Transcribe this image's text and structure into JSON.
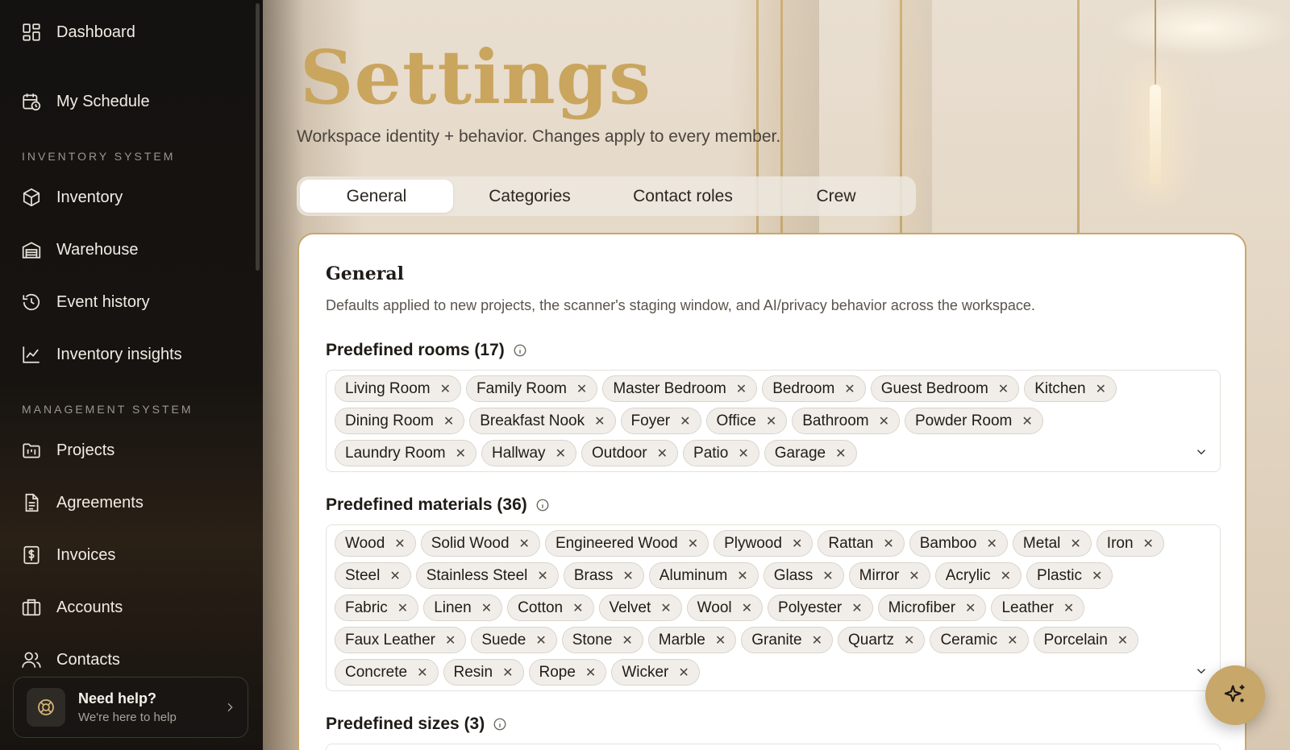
{
  "sidebar": {
    "items_top": [
      {
        "label": "Dashboard",
        "icon": "grid-icon"
      },
      {
        "label": "My Schedule",
        "icon": "calendar-clock-icon"
      }
    ],
    "section_inventory": "INVENTORY SYSTEM",
    "items_inventory": [
      {
        "label": "Inventory",
        "icon": "box-icon"
      },
      {
        "label": "Warehouse",
        "icon": "warehouse-icon"
      },
      {
        "label": "Event history",
        "icon": "history-icon"
      },
      {
        "label": "Inventory insights",
        "icon": "line-chart-icon"
      }
    ],
    "section_management": "MANAGEMENT SYSTEM",
    "items_management": [
      {
        "label": "Projects",
        "icon": "folder-kanban-icon"
      },
      {
        "label": "Agreements",
        "icon": "document-icon"
      },
      {
        "label": "Invoices",
        "icon": "invoice-dollar-icon"
      },
      {
        "label": "Accounts",
        "icon": "building-icon"
      },
      {
        "label": "Contacts",
        "icon": "users-icon"
      }
    ],
    "help": {
      "title": "Need help?",
      "subtitle": "We're here to help"
    }
  },
  "header": {
    "title": "Settings",
    "subtitle": "Workspace identity + behavior. Changes apply to every member."
  },
  "tabs": [
    {
      "label": "General",
      "active": true
    },
    {
      "label": "Categories",
      "active": false
    },
    {
      "label": "Contact roles",
      "active": false
    },
    {
      "label": "Crew",
      "active": false
    }
  ],
  "card": {
    "title": "General",
    "description": "Defaults applied to new projects, the scanner's staging window, and AI/privacy behavior across the workspace.",
    "rooms": {
      "label": "Predefined rooms (17)",
      "items": [
        "Living Room",
        "Family Room",
        "Master Bedroom",
        "Bedroom",
        "Guest Bedroom",
        "Kitchen",
        "Dining Room",
        "Breakfast Nook",
        "Foyer",
        "Office",
        "Bathroom",
        "Powder Room",
        "Laundry Room",
        "Hallway",
        "Outdoor",
        "Patio",
        "Garage"
      ]
    },
    "materials": {
      "label": "Predefined materials (36)",
      "items": [
        "Wood",
        "Solid Wood",
        "Engineered Wood",
        "Plywood",
        "Rattan",
        "Bamboo",
        "Metal",
        "Iron",
        "Steel",
        "Stainless Steel",
        "Brass",
        "Aluminum",
        "Glass",
        "Mirror",
        "Acrylic",
        "Plastic",
        "Fabric",
        "Linen",
        "Cotton",
        "Velvet",
        "Wool",
        "Polyester",
        "Microfiber",
        "Leather",
        "Faux Leather",
        "Suede",
        "Stone",
        "Marble",
        "Granite",
        "Quartz",
        "Ceramic",
        "Porcelain",
        "Concrete",
        "Resin",
        "Rope",
        "Wicker"
      ]
    },
    "sizes": {
      "label": "Predefined sizes (3)"
    }
  },
  "colors": {
    "accent_gold": "#c9a55e",
    "sidebar_bg": "#141210",
    "card_border": "#c7a86c"
  }
}
